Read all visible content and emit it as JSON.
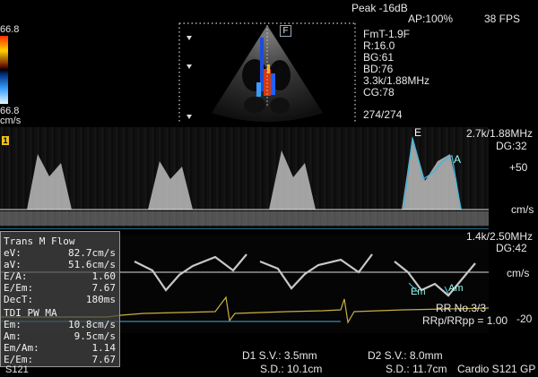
{
  "header": {
    "power": "Peak -16dB",
    "ap": "AP:100%",
    "fps": "38 FPS"
  },
  "colorbar": {
    "top_value": "66.8",
    "bottom_value": "66.8",
    "unit": "cm/s",
    "top_color": "#ff2a00",
    "bottom_color": "#3aa0ff"
  },
  "probe_marker": "F",
  "image_params": {
    "fmt": "FmT-1.9F",
    "r": "R:16.0",
    "bg": "BG:61",
    "bd": "BD:76",
    "freq": "3.3k/1.88MHz",
    "cg": "CG:78",
    "frames": "274/274"
  },
  "pw_panel": {
    "prf": "2.7k/1.88MHz",
    "dg": "DG:32",
    "scale_label": "+50",
    "unit": "cm/s",
    "marker_e": "E",
    "marker_a": "A",
    "tag": "1"
  },
  "tdi_panel": {
    "prf": "1.4k/2.50MHz",
    "dg": "DG:42",
    "unit": "cm/s",
    "marker_em": "Em",
    "marker_am": "Am",
    "rr_no": "RR No.3/3",
    "rr_ratio": "RRp/RRpp = 1.00",
    "scale_label": "-20"
  },
  "measurements": {
    "title": "Trans M Flow",
    "trans_rows": [
      {
        "label": "eV:",
        "value": "82.7cm/s"
      },
      {
        "label": "aV:",
        "value": "51.6cm/s"
      },
      {
        "label": "E/A:",
        "value": "1.60"
      },
      {
        "label": "E/Em:",
        "value": "7.67"
      },
      {
        "label": "DecT:",
        "value": "180ms"
      }
    ],
    "tdi_title": "TDI PW MA",
    "tdi_rows": [
      {
        "label": "Em:",
        "value": "10.8cm/s"
      },
      {
        "label": "Am:",
        "value": "9.5cm/s"
      },
      {
        "label": "Em/Am:",
        "value": "1.14"
      },
      {
        "label": "E/Em:",
        "value": "7.67"
      }
    ]
  },
  "footer": {
    "probe": "S121",
    "d1_sv": "D1  S.V.:  3.5mm",
    "d1_sd": "S.D.: 10.1cm",
    "d2_sv": "D2  S.V.:  8.0mm",
    "d2_sd": "S.D.: 11.7cm",
    "preset": "Cardio S121 GP"
  }
}
